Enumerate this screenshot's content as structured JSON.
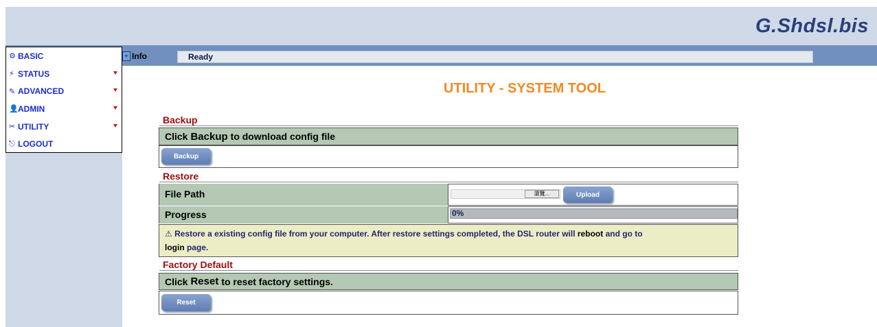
{
  "brand": "G.Shdsl.bis",
  "menu": [
    {
      "icon": "⚙",
      "label": "BASIC",
      "has_arrow": false
    },
    {
      "icon": "⚡",
      "label": "STATUS",
      "has_arrow": true
    },
    {
      "icon": "✎",
      "label": "ADVANCED",
      "has_arrow": true
    },
    {
      "icon": "👤",
      "label": "ADMIN",
      "has_arrow": true
    },
    {
      "icon": "✂",
      "label": "UTILITY",
      "has_arrow": true
    },
    {
      "icon": "⎋",
      "label": "LOGOUT",
      "has_arrow": false
    }
  ],
  "info": {
    "label": "Info",
    "status": "Ready"
  },
  "page_title": "UTILITY - SYSTEM TOOL",
  "backup": {
    "section": "Backup",
    "instruction_prefix": "Click ",
    "instruction_keyword": "Backup",
    "instruction_suffix": " to download config file",
    "button": "Backup"
  },
  "restore": {
    "section": "Restore",
    "file_path_label": "File Path",
    "browse_label": "瀏覽...",
    "upload_button": "Upload",
    "progress_label": "Progress",
    "progress_value": "0%",
    "progress_fraction": 0,
    "note_icon": "⚠",
    "note_text_1": " Restore a existing config file from your computer. After restore settings completed, the DSL router will ",
    "note_keyword_1": "reboot",
    "note_text_2": " and go to ",
    "note_keyword_2": "login",
    "note_text_3": " page."
  },
  "factory": {
    "section": "Factory Default",
    "instruction_prefix": "Click ",
    "instruction_keyword": "Reset",
    "instruction_suffix": " to reset factory settings.",
    "button": "Reset"
  }
}
